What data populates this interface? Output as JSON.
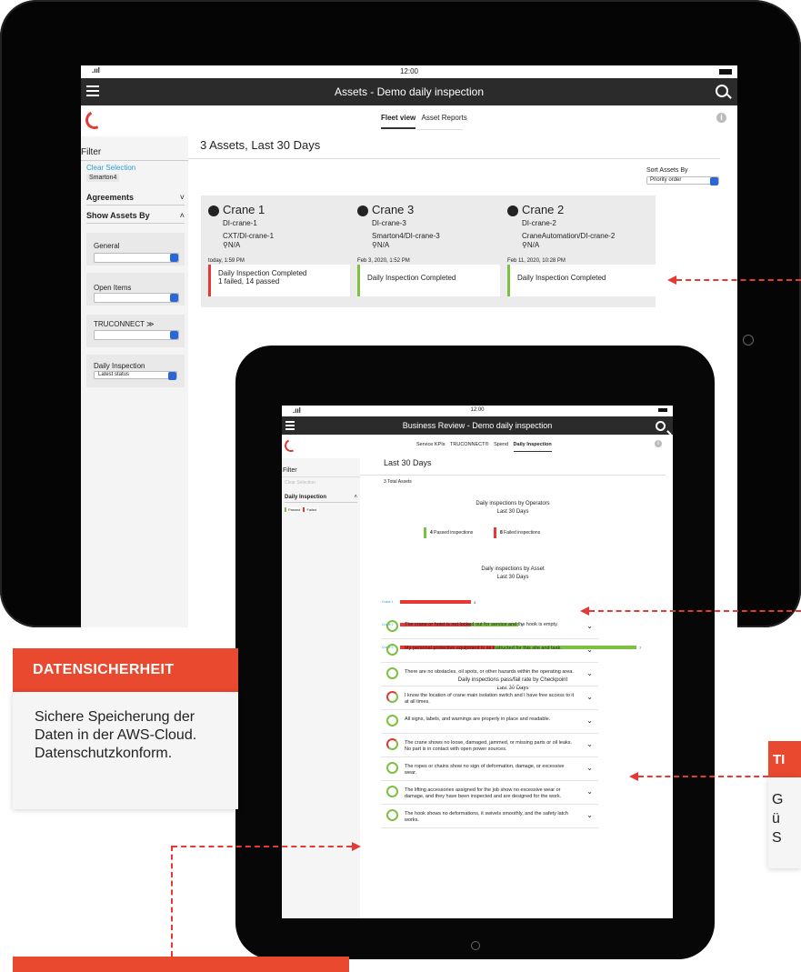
{
  "tablet1": {
    "status_time": "12:00",
    "signal": ".ııl",
    "title": "Assets - Demo daily inspection",
    "tabs": [
      "Fleet view",
      "Asset Reports"
    ],
    "info_icon": "i",
    "filter_title": "Filter",
    "clear_selection": "Clear Selection",
    "chip": "Smarton4",
    "agreements": "Agreements",
    "show_assets_by": "Show Assets By",
    "filters": [
      {
        "label": "General",
        "value": ""
      },
      {
        "label": "Open Items",
        "value": ""
      },
      {
        "label": "TRUCONNECT",
        "value": ""
      },
      {
        "label": "Daily Inspection",
        "value": "Latest status"
      }
    ],
    "heading": "3 Assets, Last 30 Days",
    "sort_label": "Sort Assets By",
    "sort_value": "Priority order",
    "cards": [
      {
        "name": "Crane 1",
        "id": "DI-crane-1",
        "path": "CXT/DI-crane-1",
        "loc": "N/A",
        "time": "today, 1:59 PM",
        "status": "Daily Inspection Completed",
        "detail": "1 failed, 14 passed"
      },
      {
        "name": "Crane 3",
        "id": "DI-crane-3",
        "path": "Smarton4/DI-crane-3",
        "loc": "N/A",
        "time": "Feb 3, 2020, 1:52 PM",
        "status": "Daily Inspection Completed",
        "detail": ""
      },
      {
        "name": "Crane 2",
        "id": "DI-crane-2",
        "path": "CraneAutomation/DI-crane-2",
        "loc": "N/A",
        "time": "Feb 11, 2020, 10:28 PM",
        "status": "Daily Inspection Completed",
        "detail": ""
      }
    ]
  },
  "tablet2": {
    "status_time": "12:00",
    "signal": ".ııl",
    "title": "Business Review - Demo daily inspection",
    "tabs": [
      "Service KPIs",
      "TRUCONNECT®",
      "Spend",
      "Daily Inspection"
    ],
    "filter_title": "Filter",
    "clear_selection": "Clear Selection",
    "daily_inspection": "Daily Inspection",
    "legend_passed": "Passed",
    "legend_failed": "Failed",
    "heading": "Last 30 Days",
    "total_assets": "3 Total Assets",
    "operators_title": "Daily inspections by Operators",
    "operators_sub": "Last 30 Days",
    "passed_count": "4",
    "passed_label": "Passed inspections",
    "failed_count": "8",
    "failed_label": "Failed inspections",
    "asset_title": "Daily inspections by Asset",
    "asset_sub": "Last 30 Days",
    "checkpoint_title": "Daily inspections pass/fail rate by Checkpoint",
    "checkpoint_sub": "Last 30 Days",
    "checkpoints": [
      {
        "text": "The crane or hoist is not locked out for service and the hook is empty.",
        "failed": false
      },
      {
        "text": "My personal protective equipment is as instructed for this site and task.",
        "failed": false
      },
      {
        "text": "There are no obstacles, oil spots, or other hazards within the operating area.",
        "failed": false
      },
      {
        "text": "I know the location of crane main isolation switch and I have free access to it at all times.",
        "failed": true
      },
      {
        "text": "All signs, labels, and warnings are properly in place and readable.",
        "failed": false
      },
      {
        "text": "The crane shows no loose, damaged, jammed, or missing parts or oil leaks. No part is in contact with open power sources.",
        "failed": true
      },
      {
        "text": "The ropes or chains show no sign of deformation, damage, or excessive wear.",
        "failed": false
      },
      {
        "text": "The lifting accessories assigned for the job show no excessive wear or damage, and they have been inspected and are designed for the work.",
        "failed": false
      },
      {
        "text": "The hook shows no deformations, it swivels smoothly, and the safety latch works.",
        "failed": false
      }
    ]
  },
  "chart_data": {
    "type": "bar",
    "title": "Daily inspections by Asset",
    "subtitle": "Last 30 Days",
    "categories": [
      "Crane 1",
      "Crane 2",
      "Crane 3"
    ],
    "series": [
      {
        "name": "Failed",
        "values": [
          3,
          3,
          4
        ]
      },
      {
        "name": "Passed",
        "values": [
          0,
          2,
          6
        ]
      }
    ],
    "totals": [
      3,
      5,
      7
    ],
    "colors": {
      "failed": "#e53935",
      "passed": "#7cc142"
    }
  },
  "callout_left": {
    "title": "DATENSICHERHEIT",
    "body": "Sichere Speicherung der Daten in der AWS-Cloud. Datenschutzkonform."
  },
  "callout_right": {
    "title": "TI",
    "body_line1": "G",
    "body_line2": "ü",
    "body_line3": "S"
  }
}
